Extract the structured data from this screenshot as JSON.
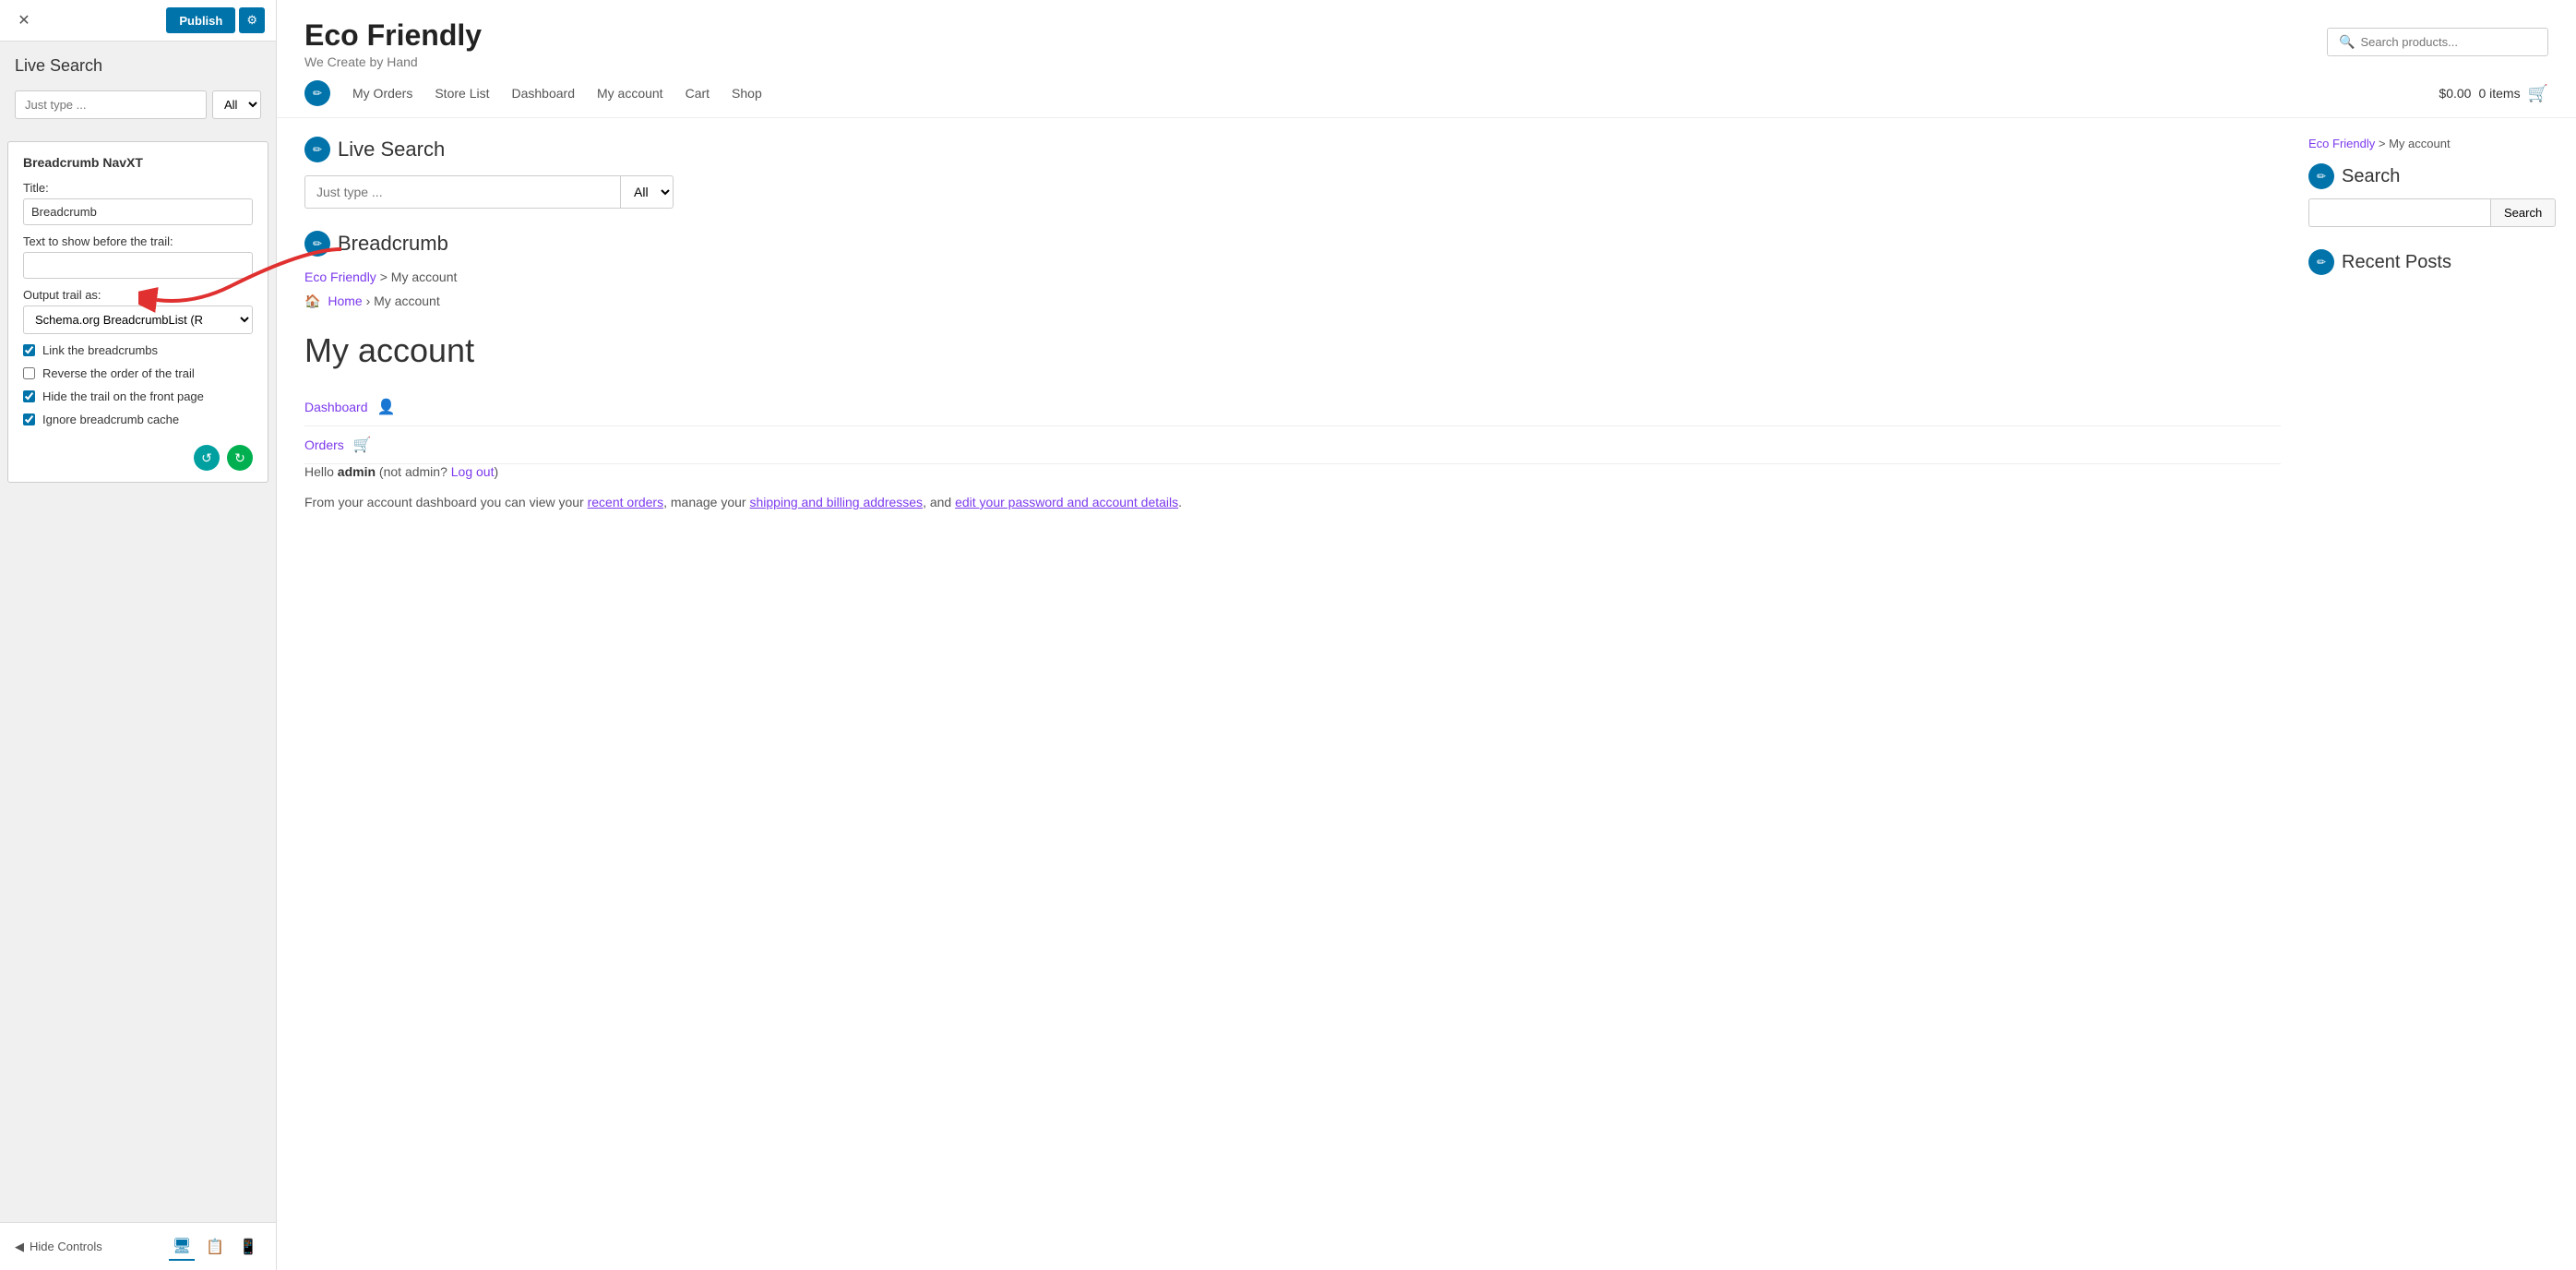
{
  "topbar": {
    "publish_label": "Publish",
    "gear_icon": "⚙"
  },
  "left_panel": {
    "title": "Live Search",
    "search_placeholder": "Just type ...",
    "search_options": [
      "All"
    ],
    "widget": {
      "title": "Breadcrumb NavXT",
      "title_label": "Title:",
      "title_value": "Breadcrumb",
      "before_trail_label": "Text to show before the trail:",
      "before_trail_value": "",
      "output_trail_label": "Output trail as:",
      "output_trail_value": "Schema.org BreadcrumbList (R",
      "checkboxes": [
        {
          "label": "Link the breadcrumbs",
          "checked": true
        },
        {
          "label": "Reverse the order of the trail",
          "checked": false
        },
        {
          "label": "Hide the trail on the front page",
          "checked": true
        },
        {
          "label": "Ignore breadcrumb cache",
          "checked": true
        }
      ]
    },
    "bottom": {
      "hide_controls": "Hide Controls"
    }
  },
  "site": {
    "title": "Eco Friendly",
    "tagline": "We Create by Hand",
    "search_placeholder": "Search products...",
    "cart_amount": "$0.00",
    "cart_items": "0 items",
    "nav": [
      "My Orders",
      "Store List",
      "Dashboard",
      "My account",
      "Cart",
      "Shop"
    ]
  },
  "live_search_section": {
    "title": "Live Search",
    "input_placeholder": "Just type ...",
    "select_options": [
      "All"
    ]
  },
  "breadcrumb_section": {
    "title": "Breadcrumb",
    "trail1_link": "Eco Friendly",
    "trail1_sep": ">",
    "trail1_text": "My account",
    "home_link": "Home",
    "trail2_sep": "›",
    "trail2_text": "My account"
  },
  "account_section": {
    "title": "My account",
    "hello_text": "Hello",
    "username": "admin",
    "not_text": "(not",
    "not_user": "admin",
    "logout_text": "Log out",
    "desc": "From your account dashboard you can view your",
    "recent_orders_link": "recent orders",
    "manage_text": ", manage your",
    "shipping_link": "shipping and billing addresses",
    "and_text": ", and",
    "password_link": "edit your password and account details",
    "links": [
      {
        "label": "Dashboard",
        "icon": "👤"
      },
      {
        "label": "Orders",
        "icon": "🛒"
      }
    ]
  },
  "sidebar": {
    "breadcrumb_link": "Eco Friendly",
    "breadcrumb_sep": ">",
    "breadcrumb_text": "My account",
    "search_widget_title": "Search",
    "search_placeholder": "",
    "search_button": "Search",
    "recent_posts_title": "Recent Posts"
  }
}
